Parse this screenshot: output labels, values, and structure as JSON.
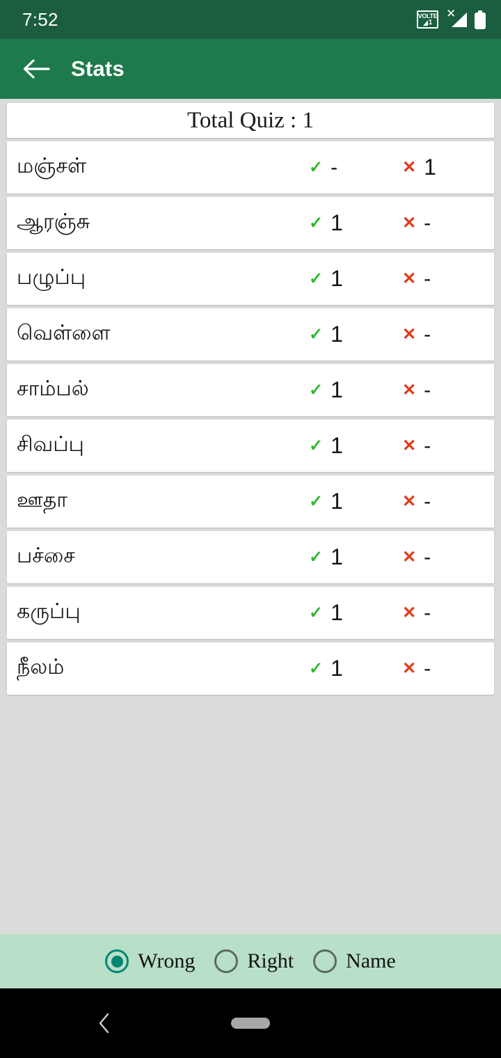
{
  "status_bar": {
    "time": "7:52",
    "volte_label": "VOLTE",
    "volte_bars": "1",
    "signal_x": "✕",
    "icons": [
      "volte-icon",
      "signal-icon",
      "battery-icon"
    ]
  },
  "app_bar": {
    "back_icon": "back-arrow-icon",
    "title": "Stats"
  },
  "header": {
    "total_quiz_text": "Total Quiz : 1"
  },
  "columns": {
    "right_mark": "✓",
    "wrong_mark": "✕"
  },
  "rows": [
    {
      "name": "மஞ்சள்",
      "right": "-",
      "wrong": "1"
    },
    {
      "name": "ஆரஞ்சு",
      "right": "1",
      "wrong": "-"
    },
    {
      "name": "பழுப்பு",
      "right": "1",
      "wrong": "-"
    },
    {
      "name": "வெள்ளை",
      "right": "1",
      "wrong": "-"
    },
    {
      "name": "சாம்பல்",
      "right": "1",
      "wrong": "-"
    },
    {
      "name": "சிவப்பு",
      "right": "1",
      "wrong": "-"
    },
    {
      "name": "ஊதா",
      "right": "1",
      "wrong": "-"
    },
    {
      "name": "பச்சை",
      "right": "1",
      "wrong": "-"
    },
    {
      "name": "கருப்பு",
      "right": "1",
      "wrong": "-"
    },
    {
      "name": "நீலம்",
      "right": "1",
      "wrong": "-"
    }
  ],
  "sort_options": [
    {
      "label": "Wrong",
      "selected": true
    },
    {
      "label": "Right",
      "selected": false
    },
    {
      "label": "Name",
      "selected": false
    }
  ],
  "nav_bar": {
    "back_icon": "chevron-left-icon",
    "home_icon": "home-pill-icon"
  },
  "colors": {
    "status_bar": "#1b5e3f",
    "app_bar": "#1e7a4c",
    "page_bg": "#dbdbdb",
    "card": "#ffffff",
    "option_bar": "#b8dfc8",
    "radio_selected": "#008573",
    "radio_unselected": "#5a6b60",
    "check_green": "#2eb82e",
    "cross_red": "#e03a1a",
    "nav_bar": "#000000"
  }
}
